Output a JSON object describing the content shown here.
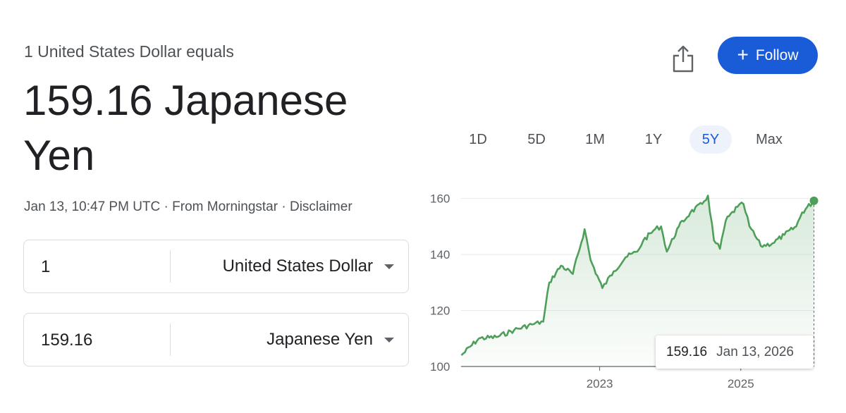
{
  "header": {
    "subtitle": "1 United States Dollar equals",
    "value_line": "159.16 Japanese Yen"
  },
  "meta": {
    "timestamp": "Jan 13, 10:47 PM UTC",
    "separator": " · ",
    "source": "From Morningstar",
    "disclaimer": "Disclaimer"
  },
  "actions": {
    "share_icon": "share-icon",
    "follow_label": "Follow",
    "follow_icon": "+"
  },
  "converter": {
    "from": {
      "amount": "1",
      "currency": "United States Dollar"
    },
    "to": {
      "amount": "159.16",
      "currency": "Japanese Yen"
    }
  },
  "ranges": {
    "tabs": [
      "1D",
      "5D",
      "1M",
      "1Y",
      "5Y",
      "Max"
    ],
    "active": "5Y"
  },
  "tooltip": {
    "value": "159.16",
    "date": "Jan 13, 2026"
  },
  "colors": {
    "line": "#4e9f5a",
    "accent": "#1a5cd8"
  },
  "chart_data": {
    "type": "area",
    "title": "",
    "xlabel": "",
    "ylabel": "",
    "x_ticks": [
      "2023",
      "2025"
    ],
    "y_ticks": [
      "100",
      "120",
      "140",
      "160"
    ],
    "ylim": [
      100,
      162
    ],
    "xlim": [
      "2021-01-13",
      "2026-01-13"
    ],
    "series": [
      {
        "x": [
          "2021-01",
          "2021-04",
          "2021-07",
          "2021-10",
          "2022-01",
          "2022-03",
          "2022-04",
          "2022-06",
          "2022-08",
          "2022-10",
          "2022-11",
          "2023-01",
          "2023-03",
          "2023-05",
          "2023-07",
          "2023-08",
          "2023-10",
          "2023-11",
          "2023-12",
          "2024-02",
          "2024-04",
          "2024-06",
          "2024-07",
          "2024-08",
          "2024-09",
          "2024-10",
          "2024-12",
          "2025-01",
          "2025-02",
          "2025-04",
          "2025-06",
          "2025-08",
          "2025-10",
          "2025-11",
          "2026-01"
        ],
        "y": [
          104,
          110,
          110.5,
          113,
          115,
          116,
          130,
          136,
          133,
          149,
          138,
          128,
          134,
          139,
          141,
          145,
          149,
          150,
          141,
          150,
          155,
          158,
          161,
          145,
          142,
          152,
          157,
          158,
          150,
          143,
          144,
          147,
          150,
          155,
          159.16
        ]
      }
    ]
  }
}
